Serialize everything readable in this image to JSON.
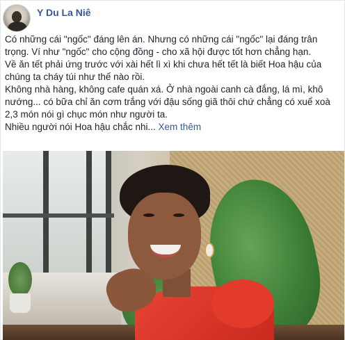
{
  "post": {
    "author_name": "Y Du La Niê",
    "body_lines": [
      "Có những cái \"ngốc\" đáng lên án. Nhưng có những cái \"ngốc\" lại đáng trân",
      "trọng. Ví như \"ngốc\" cho cộng đồng - cho xã hội được tốt hơn chẳng hạn.",
      "Về ăn tết phải ứng trước với xài hết lì xì khi chưa hết tết là biết Hoa hậu của",
      "chúng ta cháy túi như thế nào rồi.",
      "Không nhà hàng, không cafe quán xá. Ở nhà ngoài canh cà đắng, lá mì, khô",
      "nướng... có bữa chỉ ăn cơm trắng với đậu sống giã thôi chứ chẳng có xuể xoà",
      "2,3 món nói gì chục món như người ta."
    ],
    "last_line": "Nhiều người nói Hoa hậu chắc nhi...",
    "see_more_label": "Xem thêm"
  },
  "colors": {
    "link": "#365899",
    "text": "#1d2129",
    "border": "#e5e6e9"
  },
  "icons": [
    "avatar-photo"
  ]
}
